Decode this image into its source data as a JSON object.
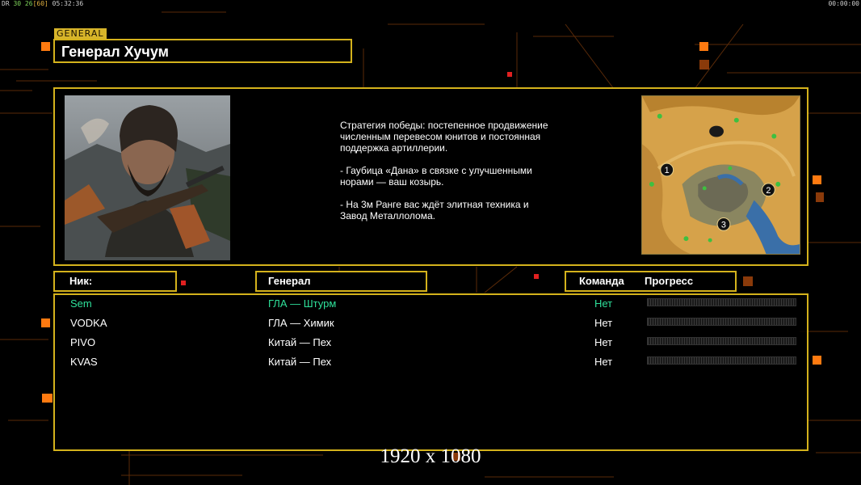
{
  "hud": {
    "top_left_prefix": "DR",
    "top_left_fps": "30 26",
    "top_left_limit": "[60]",
    "top_left_time": "05:32:36",
    "top_right_time": "00:00:00"
  },
  "tag": "GENERAL",
  "general_name": "Генерал Хучум",
  "description": [
    "Стратегия победы: постепенное продвижение численным перевесом юнитов и постоянная поддержка артиллерии.",
    "- Гаубица «Дана» в связке с улучшенными норами — ваш козырь.",
    "- На 3м Ранге вас ждёт элитная техника и Завод Металлолома."
  ],
  "headers": {
    "nick": "Ник:",
    "general": "Генерал",
    "team": "Команда",
    "progress": "Прогресс"
  },
  "players": [
    {
      "nick": "Sem",
      "general": "ГЛА — Штурм",
      "team": "Нет",
      "progress": 0
    },
    {
      "nick": "VODKA",
      "general": "ГЛА — Химик",
      "team": "Нет",
      "progress": 0
    },
    {
      "nick": "PIVO",
      "general": "Китай — Пех",
      "team": "Нет",
      "progress": 0
    },
    {
      "nick": "KVAS",
      "general": "Китай — Пех",
      "team": "Нет",
      "progress": 0
    }
  ],
  "map_markers": [
    "1",
    "2",
    "3"
  ],
  "resolution_label": "1920 x 1080",
  "colors": {
    "accent": "#d4b21c",
    "orange": "#ff7a10",
    "local_player": "#2fe09a"
  }
}
